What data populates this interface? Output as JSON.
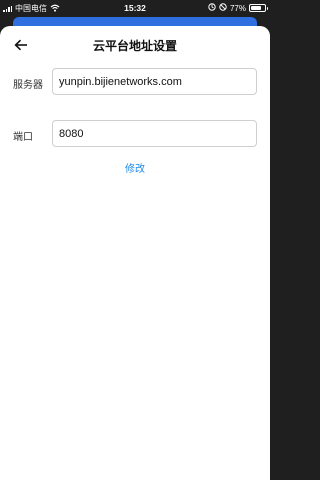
{
  "status_bar": {
    "carrier": "中国电信",
    "time": "15:32",
    "battery": "77%",
    "battery_level": 0.77
  },
  "header": {
    "title": "云平台地址设置",
    "back_icon": "arrow-left-icon"
  },
  "form": {
    "server_label": "服务器",
    "server_value": "yunpin.bijienetworks.com",
    "port_label": "端口",
    "port_value": "8080",
    "modify_label": "修改"
  },
  "colors": {
    "accent": "#2f6fe0",
    "link": "#1e88e5"
  }
}
